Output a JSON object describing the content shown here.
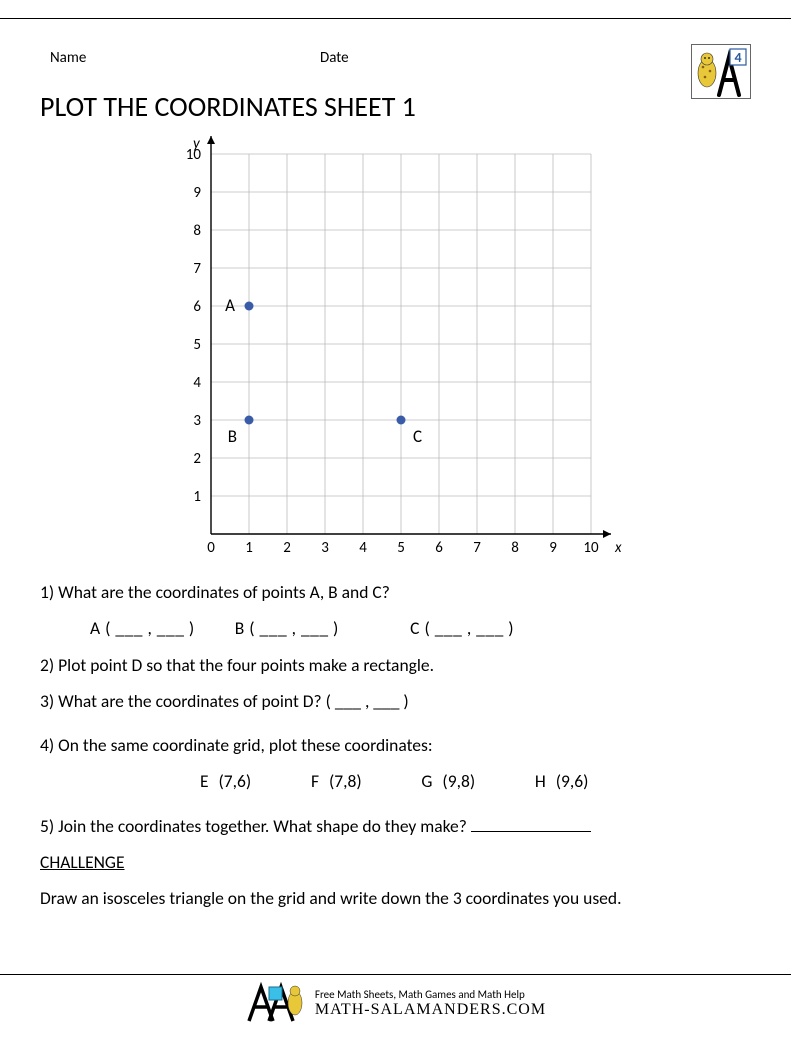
{
  "header": {
    "name_label": "Name",
    "date_label": "Date",
    "badge_number": "4"
  },
  "title": "PLOT THE COORDINATES SHEET 1",
  "chart_data": {
    "type": "scatter",
    "xlabel": "x",
    "ylabel": "y",
    "xlim": [
      0,
      10
    ],
    "ylim": [
      0,
      10
    ],
    "xticks": [
      0,
      1,
      2,
      3,
      4,
      5,
      6,
      7,
      8,
      9,
      10
    ],
    "yticks": [
      0,
      1,
      2,
      3,
      4,
      5,
      6,
      7,
      8,
      9,
      10
    ],
    "points": [
      {
        "label": "A",
        "x": 1,
        "y": 6,
        "label_pos": "left"
      },
      {
        "label": "B",
        "x": 1,
        "y": 3,
        "label_pos": "below-left"
      },
      {
        "label": "C",
        "x": 5,
        "y": 3,
        "label_pos": "below-right"
      }
    ]
  },
  "questions": {
    "q1": "1)  What are the coordinates of points A, B and C?",
    "q1_blanks": "A ( ___ , ___ )         B ( ___ , ___ )                C ( ___ , ___ )",
    "q2": "2)  Plot point D so that the four points make a rectangle.",
    "q3": "3)  What are the coordinates of point D? ( ___ , ___ )",
    "q4": "4) On the same coordinate grid, plot these coordinates:",
    "q4_coords": "E (7,6)      F (7,8)      G (9,8)      H (9,6)",
    "q5_a": "5) Join the coordinates together. What shape do they make? ",
    "challenge_label": "CHALLENGE",
    "challenge_text": "Draw an isosceles triangle on the grid and write down the 3 coordinates you used."
  },
  "footer": {
    "tagline": "Free Math Sheets, Math Games and Math Help",
    "site": "MATH-SALAMANDERS.COM"
  }
}
